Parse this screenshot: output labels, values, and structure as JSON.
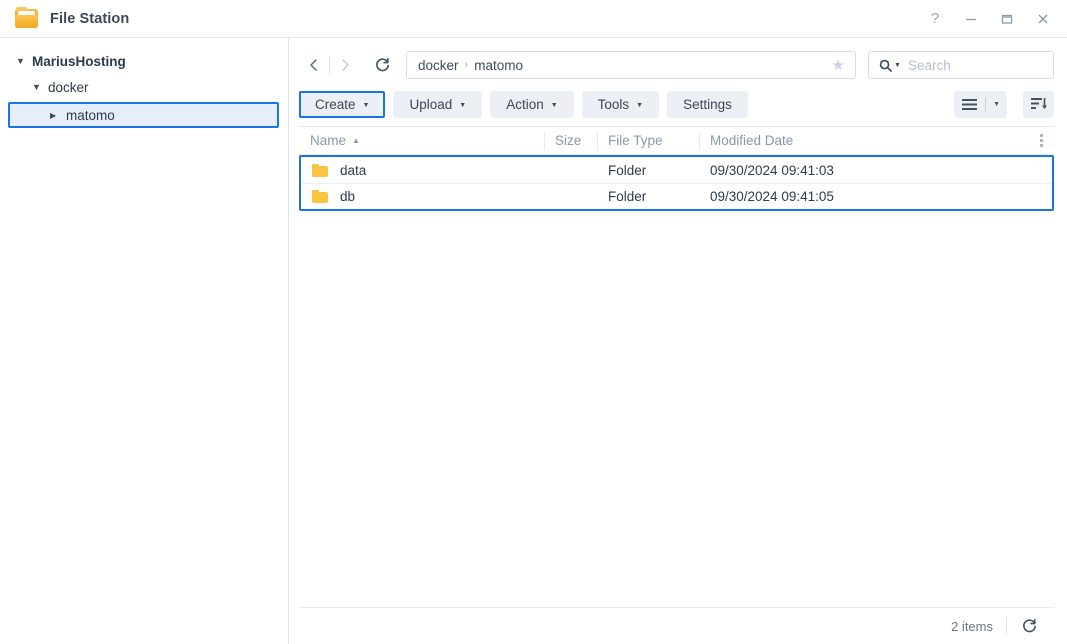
{
  "titlebar": {
    "app_name": "File Station",
    "icon": "folder-icon",
    "controls": [
      {
        "name": "help-button",
        "glyph": "?"
      },
      {
        "name": "minimize-button",
        "glyph": "minimize-icon"
      },
      {
        "name": "maximize-button",
        "glyph": "maximize-icon"
      },
      {
        "name": "close-button",
        "glyph": "close-icon"
      }
    ]
  },
  "sidebar": {
    "tree": [
      {
        "label": "MariusHosting",
        "level": 0,
        "state": "expanded",
        "selected": false
      },
      {
        "label": "docker",
        "level": 1,
        "state": "expanded",
        "selected": false
      },
      {
        "label": "matomo",
        "level": 2,
        "state": "collapsed",
        "selected": true
      }
    ]
  },
  "navbar": {
    "back_icon": "chevron-left-icon",
    "forward_icon": "chevron-right-icon",
    "reload_icon": "refresh-icon",
    "breadcrumb": [
      "docker",
      "matomo"
    ],
    "breadcrumb_separator": "›",
    "favorite_icon": "star-icon",
    "search": {
      "icon": "search-icon",
      "value": "",
      "placeholder": "Search"
    }
  },
  "toolbar": {
    "buttons": [
      {
        "label": "Create",
        "has_caret": true,
        "highlighted": true
      },
      {
        "label": "Upload",
        "has_caret": true,
        "highlighted": false
      },
      {
        "label": "Action",
        "has_caret": true,
        "highlighted": false
      },
      {
        "label": "Tools",
        "has_caret": true,
        "highlighted": false
      },
      {
        "label": "Settings",
        "has_caret": false,
        "highlighted": false
      }
    ],
    "view_mode_icon": "list-view-icon",
    "view_mode_caret": "chevron-down-icon",
    "sort_icon": "sort-descending-icon"
  },
  "file_list": {
    "columns": [
      {
        "key": "name",
        "label": "Name",
        "sorted": "asc"
      },
      {
        "key": "size",
        "label": "Size",
        "sorted": ""
      },
      {
        "key": "type",
        "label": "File Type",
        "sorted": ""
      },
      {
        "key": "date",
        "label": "Modified Date",
        "sorted": ""
      }
    ],
    "column_options_icon": "more-options-icon",
    "selection_highlighted": true,
    "rows": [
      {
        "icon": "folder-icon",
        "name": "data",
        "size": "",
        "type": "Folder",
        "date": "09/30/2024 09:41:03"
      },
      {
        "icon": "folder-icon",
        "name": "db",
        "size": "",
        "type": "Folder",
        "date": "09/30/2024 09:41:05"
      }
    ]
  },
  "statusbar": {
    "items_count": "2 items",
    "refresh_icon": "refresh-icon"
  },
  "colors": {
    "accent": "#1a73e8",
    "folder": "#fbc63f",
    "toolbar_button": "#eceff3",
    "text": "#2f3b49",
    "muted_text": "#8c97a3"
  }
}
